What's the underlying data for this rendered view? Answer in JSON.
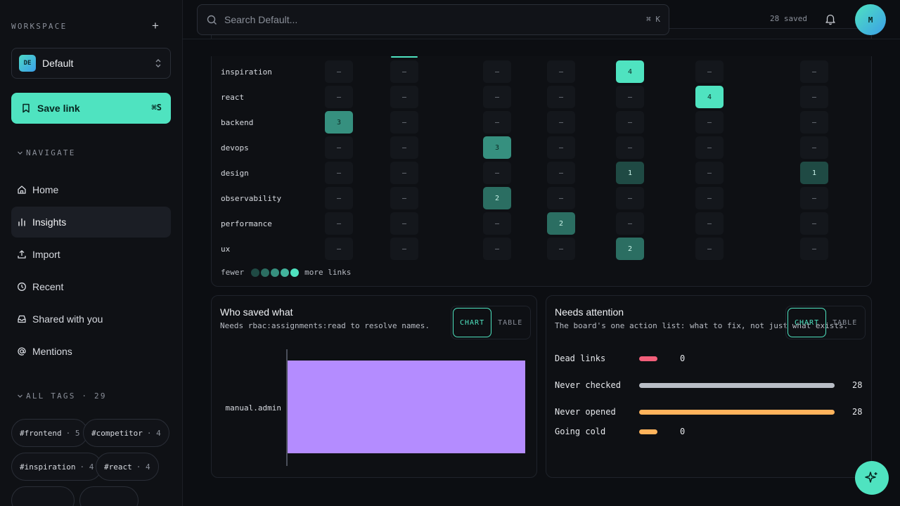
{
  "sidebar": {
    "workspace_label": "WORKSPACE",
    "workspace": {
      "badge": "DE",
      "name": "Default"
    },
    "save_button": {
      "label": "Save link",
      "shortcut": "⌘S"
    },
    "navigate_label": "NAVIGATE",
    "nav": [
      {
        "label": "Home",
        "icon": "home-icon"
      },
      {
        "label": "Insights",
        "icon": "bar-chart-icon",
        "active": true
      },
      {
        "label": "Import",
        "icon": "upload-icon"
      },
      {
        "label": "Recent",
        "icon": "clock-icon"
      },
      {
        "label": "Shared with you",
        "icon": "inbox-icon"
      },
      {
        "label": "Mentions",
        "icon": "at-icon"
      }
    ],
    "tags_label": "ALL TAGS · 29",
    "tags": [
      {
        "name": "#frontend",
        "count": "· 5"
      },
      {
        "name": "#competitor",
        "count": "· 4"
      },
      {
        "name": "#inspiration",
        "count": "· 4"
      },
      {
        "name": "#react",
        "count": "· 4"
      }
    ]
  },
  "header": {
    "search_placeholder": "Search Default...",
    "search_shortcut": "⌘ K",
    "saved_count": "28 saved",
    "avatar_initial": "M"
  },
  "heatmap": {
    "rows": [
      "inspiration",
      "react",
      "backend",
      "devops",
      "design",
      "observability",
      "performance",
      "ux"
    ],
    "cells": [
      [
        "–",
        "–",
        "–",
        "–",
        "4",
        "–",
        "–"
      ],
      [
        "–",
        "–",
        "–",
        "–",
        "–",
        "4",
        "–"
      ],
      [
        "3",
        "–",
        "–",
        "–",
        "–",
        "–",
        "–"
      ],
      [
        "–",
        "–",
        "3",
        "–",
        "–",
        "–",
        "–"
      ],
      [
        "–",
        "–",
        "–",
        "–",
        "1",
        "–",
        "1"
      ],
      [
        "–",
        "–",
        "2",
        "–",
        "–",
        "–",
        "–"
      ],
      [
        "–",
        "–",
        "–",
        "2",
        "–",
        "–",
        "–"
      ],
      [
        "–",
        "–",
        "–",
        "–",
        "2",
        "–",
        "–"
      ]
    ],
    "legend_low": "fewer",
    "legend_high": "more links",
    "colors": [
      "#1f4a44",
      "#2b6e62",
      "#36907f",
      "#42b39c",
      "#4fe3c0"
    ]
  },
  "who_saved": {
    "title": "Who saved what",
    "subtitle": "Needs rbac:assignments:read to resolve names.",
    "toggle": [
      "CHART",
      "TABLE"
    ],
    "chart_data": {
      "type": "bar",
      "orientation": "horizontal",
      "categories": [
        "manual.admin"
      ],
      "values": [
        28
      ],
      "xlim": [
        0,
        28
      ],
      "color": "#b48cff"
    }
  },
  "attention": {
    "title": "Needs attention",
    "subtitle": "The board's one action list: what to fix, not just what exists.",
    "toggle": [
      "CHART",
      "TABLE"
    ],
    "chart_data": {
      "type": "bar",
      "orientation": "horizontal",
      "categories": [
        "Dead links",
        "Never checked",
        "Never opened",
        "Going cold"
      ],
      "values": [
        0,
        28,
        28,
        0
      ],
      "xlim": [
        0,
        28
      ],
      "colors": [
        "#f25f7a",
        "#b9bec6",
        "#ffb35c",
        "#ffb35c"
      ]
    }
  }
}
